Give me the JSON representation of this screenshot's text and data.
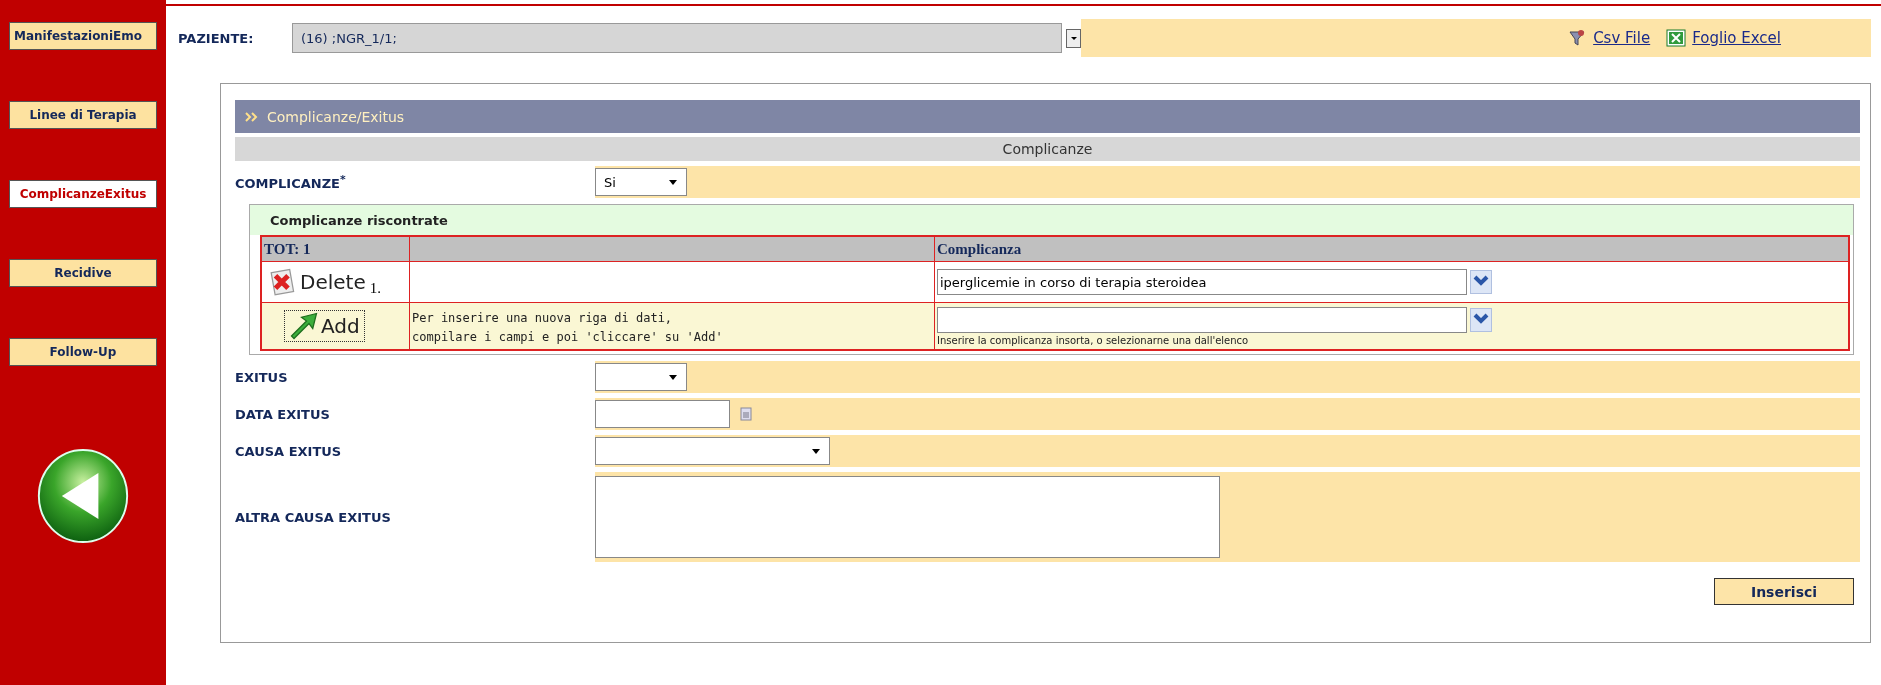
{
  "sidebar": {
    "items": [
      {
        "label": "ManifestazioniEmo",
        "selected": false
      },
      {
        "label": "Linee di Terapia",
        "selected": false
      },
      {
        "label": "ComplicanzeExitus",
        "selected": true
      },
      {
        "label": "Recidive",
        "selected": false
      },
      {
        "label": "Follow-Up",
        "selected": false
      }
    ]
  },
  "patient": {
    "label": "PAZIENTE:",
    "value": "(16) ;NGR_1/1;"
  },
  "exports": [
    {
      "kind": "csv",
      "label": "Csv File"
    },
    {
      "kind": "excel",
      "label": "Foglio Excel"
    }
  ],
  "panel": {
    "title": "Complicanze/Exitus",
    "section": "Complicanze",
    "complicanze": {
      "label": "COMPLICANZE$^{*}$",
      "value": "Si"
    },
    "subtable": {
      "title": "Complicanze riscontrate",
      "total": "TOT: 1",
      "column": "Complicanza",
      "rows": [
        {
          "action": "Delete",
          "index": "1.",
          "value": "iperglicemie in corso di terapia steroidea"
        }
      ],
      "add": {
        "action": "Add",
        "hint": "Per inserire una nuova riga di dati,\ncompilare i campi e poi 'cliccare' su 'Add'",
        "field_hint": "Inserire la complicanza insorta, o selezionarne una dall'elenco"
      }
    },
    "fields": [
      {
        "kind": "select",
        "label": "EXITUS"
      },
      {
        "kind": "date",
        "label": "DATA EXITUS"
      },
      {
        "kind": "select-wide",
        "label": "CAUSA EXITUS"
      },
      {
        "kind": "textarea",
        "label": "ALTRA CAUSA EXITUS"
      }
    ],
    "submit": "Inserisci"
  }
}
